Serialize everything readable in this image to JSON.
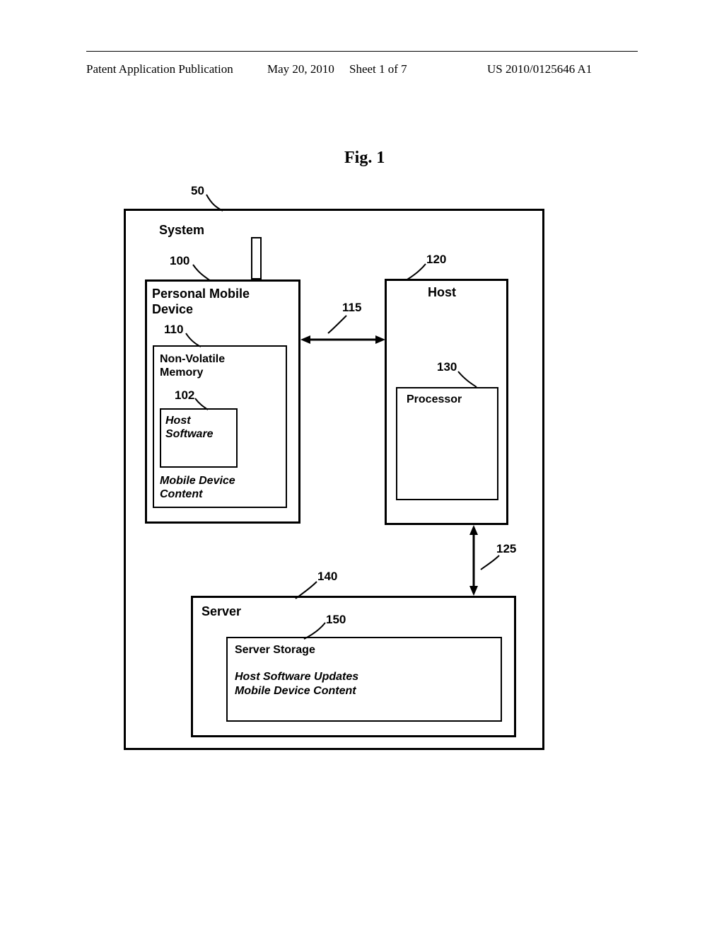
{
  "header": {
    "pub_type": "Patent Application Publication",
    "date": "May 20, 2010",
    "sheet": "Sheet 1 of 7",
    "pub_number": "US 2010/0125646 A1"
  },
  "figure": {
    "title": "Fig. 1"
  },
  "refs": {
    "system": "50",
    "pmd": "100",
    "nvm": "110",
    "host_sw": "102",
    "link_pmd_host": "115",
    "host": "120",
    "link_host_server": "125",
    "processor": "130",
    "server": "140",
    "server_storage": "150"
  },
  "labels": {
    "system": "System",
    "pmd": "Personal Mobile Device",
    "nvm": "Non-Volatile Memory",
    "host_sw": "Host Software",
    "mdc": "Mobile Device Content",
    "host": "Host",
    "processor": "Processor",
    "server": "Server",
    "server_storage": "Server Storage",
    "hsu": "Host Software Updates",
    "mdc2": "Mobile Device Content"
  }
}
